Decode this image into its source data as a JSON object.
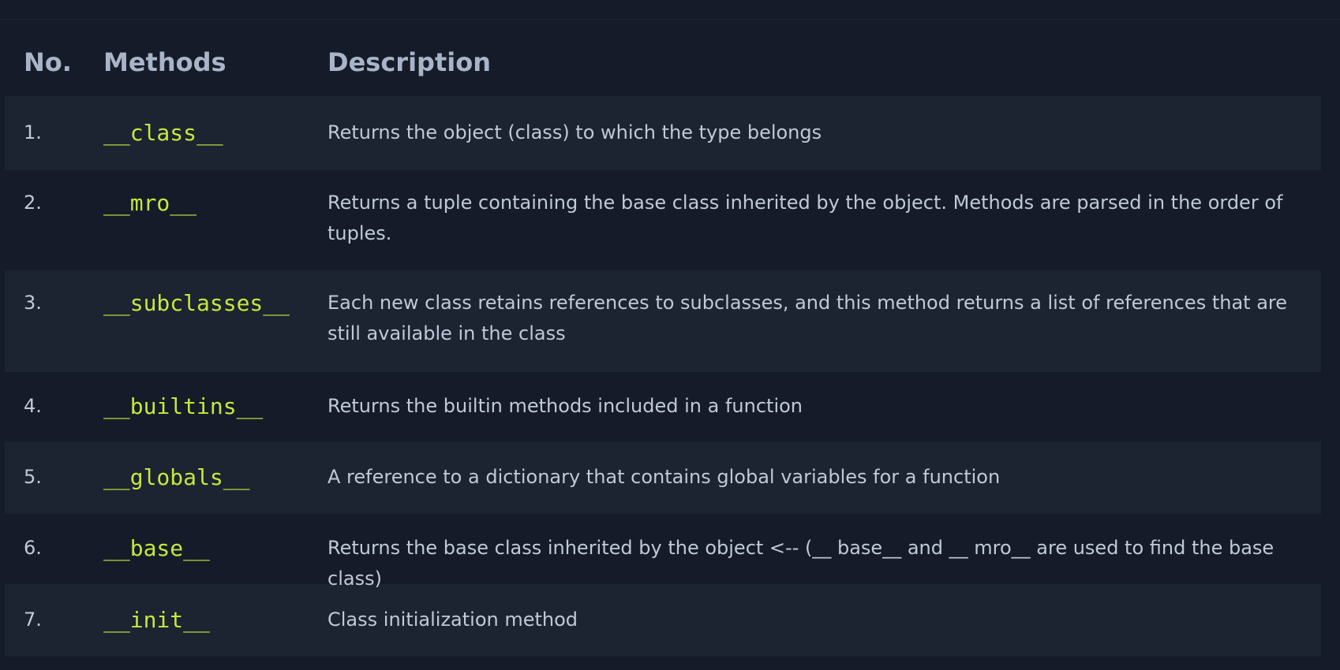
{
  "table": {
    "headers": {
      "no": "No.",
      "methods": "Methods",
      "description": "Description"
    },
    "rows": [
      {
        "no": "1.",
        "method": "__class__",
        "description": "Returns the object (class) to which the type belongs"
      },
      {
        "no": "2.",
        "method": "__mro__",
        "description": "Returns a tuple containing the base class inherited by the object. Methods are parsed in the order of tuples."
      },
      {
        "no": "3.",
        "method": "__subclasses__",
        "description": "Each new class retains references to subclasses, and this method returns a list of references that are still available in the class"
      },
      {
        "no": "4.",
        "method": "__builtins__",
        "description": "Returns the builtin methods included in a function"
      },
      {
        "no": "5.",
        "method": "__globals__",
        "description": "A reference to a dictionary that contains global variables for a function"
      },
      {
        "no": "6.",
        "method": "__base__",
        "description": "Returns the base class inherited by the object <-- (__ base__ and __ mro__ are used to find the base class)"
      },
      {
        "no": "7.",
        "method": "__init__",
        "description": "Class initialization method"
      }
    ]
  }
}
